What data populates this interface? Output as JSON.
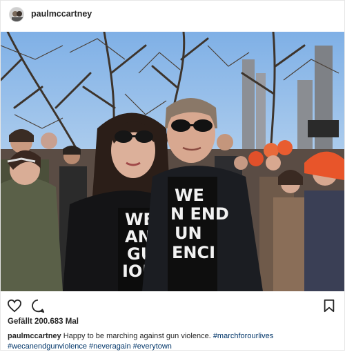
{
  "post": {
    "username": "paulmccartney",
    "likes_text": "Gefällt 200.683 Mal",
    "caption": {
      "username": "paulmccartney",
      "text": "Happy to be marching against gun violence.",
      "hashtags": [
        "#marchforourlives",
        "#wecanendgunviolence",
        "#neveragain",
        "#everytown"
      ]
    },
    "shirt_text_left": [
      "WE",
      "AN EN",
      "GUN",
      "IOLENC"
    ],
    "shirt_text_right": [
      "WE",
      "N END",
      "UN",
      "ENCI"
    ]
  },
  "icons": {
    "like": "heart-outline-icon",
    "comment": "speech-bubble-icon",
    "save": "bookmark-icon"
  },
  "colors": {
    "link": "#003569",
    "text": "#262626",
    "border": "#e6e6e6"
  }
}
